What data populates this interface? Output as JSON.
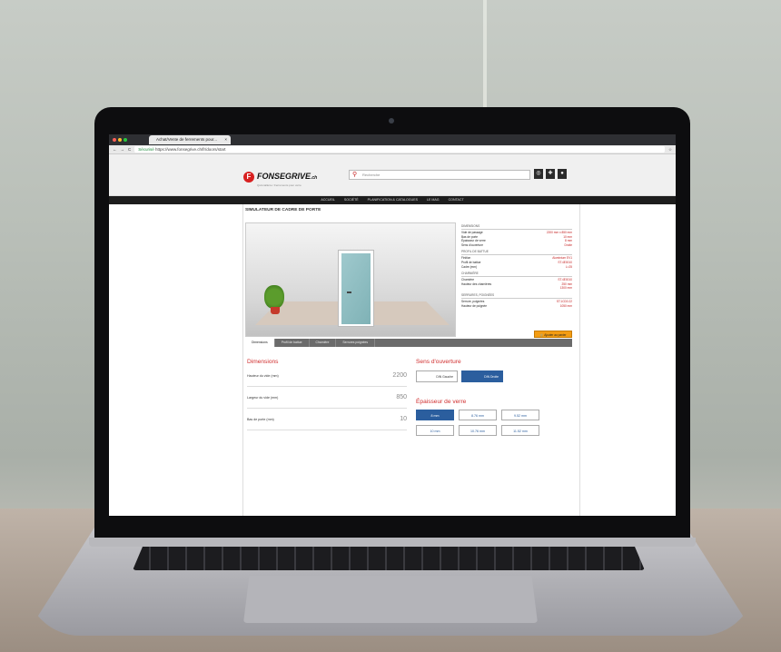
{
  "browser": {
    "tab_title": "Achat/Vente de ferrements pour...",
    "secure_label": "Sécurisé",
    "url": "https://www.fonsegrive.ch/fr/doors/start"
  },
  "site": {
    "logo": "FONSEGRIVE",
    "logo_suffix": ".ch",
    "logo_tagline": "Quincaillerie / Ferrements pour verre",
    "search_placeholder": "Recherche",
    "nav": [
      "ACCUEIL",
      "SOCIÉTÉ",
      "PLANIFICATION & CATALOGUES",
      "LE MAG",
      "CONTACT"
    ]
  },
  "page": {
    "title": "SIMULATEUR DE CADRE DE PORTE",
    "add_to_cart": "Ajouter au panier",
    "tabs": [
      "Dimensions",
      "Profil de battue",
      "Charnière",
      "Serrures poignées"
    ],
    "dimensions_heading": "Dimensions",
    "fields": [
      {
        "label": "Hauteur du vide (mm)",
        "value": "2200"
      },
      {
        "label": "Largeur du vide (mm)",
        "value": "850"
      },
      {
        "label": "Bas de porte (mm)",
        "value": "10"
      }
    ],
    "sens_heading": "Sens d'ouverture",
    "sens_options": [
      "DIN Gauche",
      "DIN Droite"
    ],
    "epaisseur_heading": "Épaisseur de verre",
    "epaisseur_options": [
      "8 mm",
      "8.76 mm",
      "9.52 mm",
      "10 mm",
      "10.76 mm",
      "11.52 mm"
    ]
  },
  "specs": [
    {
      "title": "DIMENSIONS",
      "rows": [
        {
          "k": "Vide de passage",
          "v": "2200 mm x 850 mm"
        },
        {
          "k": "Bas de porte",
          "v": "10 mm"
        },
        {
          "k": "Épaisseur de verre",
          "v": "8 mm"
        },
        {
          "k": "Sens d'ouverture",
          "v": "Droite"
        }
      ]
    },
    {
      "title": "PROFIL DE BATTUE",
      "rows": [
        {
          "k": "Finition",
          "v": "Aluminium EV1"
        },
        {
          "k": "Profil de battue",
          "v": "ST.4E0010"
        },
        {
          "k": "Cadre (mm)",
          "v": "L=25"
        }
      ]
    },
    {
      "title": "CHARNIÈRE",
      "rows": [
        {
          "k": "Charnière",
          "v": "ST.4E0010"
        },
        {
          "k": "Hauteur des charnières",
          "v": "250 mm"
        },
        {
          "k": "",
          "v": "1300 mm"
        }
      ]
    },
    {
      "title": "SERRURES, POIGNÉES",
      "rows": [
        {
          "k": "Serrure, poignées",
          "v": "ST.1CD0.22"
        },
        {
          "k": "Hauteur de poignée",
          "v": "1050 mm"
        }
      ]
    }
  ],
  "colors": {
    "brand_red": "#d82020",
    "accent_blue": "#2b5e9e",
    "cart_orange": "#f39c12"
  }
}
